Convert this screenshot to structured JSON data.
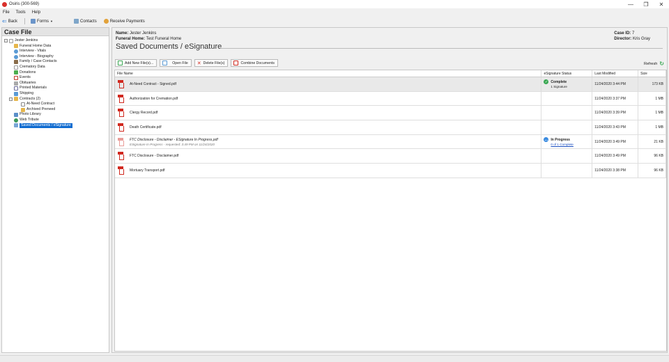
{
  "window": {
    "title": "Osiris (300-569)",
    "minimize": "—",
    "maximize": "❐",
    "close": "✕"
  },
  "menu": {
    "items": [
      "File",
      "Tools",
      "Help"
    ]
  },
  "toolbar": {
    "back": "Back",
    "forms": "Forms",
    "contacts": "Contacts",
    "receive_payments": "Receive Payments"
  },
  "case_file": {
    "title": "Case File",
    "tree": [
      {
        "label": "Jester Jenkins"
      },
      {
        "label": "Funeral Home Data"
      },
      {
        "label": "Interview - Vitals"
      },
      {
        "label": "Interview - Biography"
      },
      {
        "label": "Family / Case Contacts"
      },
      {
        "label": "Crematory Data"
      },
      {
        "label": "Donations"
      },
      {
        "label": "Events"
      },
      {
        "label": "Obituaries"
      },
      {
        "label": "Printed Materials"
      },
      {
        "label": "Shipping"
      },
      {
        "label": "Contracts (2)"
      },
      {
        "label": "At-Need Contract"
      },
      {
        "label": "Archived Preneed"
      },
      {
        "label": "Photo Library"
      },
      {
        "label": "Web Tribute"
      },
      {
        "label": "Saved Documents / eSignature"
      }
    ]
  },
  "header": {
    "name_label": "Name:",
    "name": "Jester Jenkins",
    "funeral_home_label": "Funeral Home:",
    "funeral_home": "Test Funeral Home",
    "case_id_label": "Case ID:",
    "case_id": "7",
    "director_label": "Director:",
    "director": "Kris Gray",
    "page_title": "Saved Documents / eSignature"
  },
  "actions": {
    "add": "Add New File(s)...",
    "open": "Open File",
    "delete": "Delete File(s)",
    "combine": "Combine Documents",
    "refresh": "Refresh"
  },
  "grid": {
    "columns": [
      "File Name",
      "eSignature Status",
      "Last Modified",
      "Size"
    ],
    "rows": [
      {
        "name": "At-Need Contract - Signed.pdf",
        "sub": "",
        "status": "Complete",
        "status_sub": "1 Signature",
        "modified": "11/24/2020 3:44 PM",
        "size": "173 KB"
      },
      {
        "name": "Authorization for Cremation.pdf",
        "sub": "",
        "status": "",
        "status_sub": "",
        "modified": "11/24/2020 3:37 PM",
        "size": "1 MB"
      },
      {
        "name": "Clergy Record.pdf",
        "sub": "",
        "status": "",
        "status_sub": "",
        "modified": "11/24/2020 3:39 PM",
        "size": "1 MB"
      },
      {
        "name": "Death Certificate.pdf",
        "sub": "",
        "status": "",
        "status_sub": "",
        "modified": "11/24/2020 3:43 PM",
        "size": "1 MB"
      },
      {
        "name": "FTC Disclosure - Disclaimer - ESignature In Progress.pdf",
        "sub": "ESignature In Progress - requested: 3:49 PM on 11/24/2020",
        "status": "In Progress",
        "status_sub": "0 of 1 Complete",
        "modified": "11/24/2020 3:49 PM",
        "size": "21 KB"
      },
      {
        "name": "FTC Disclosure - Disclaimer.pdf",
        "sub": "",
        "status": "",
        "status_sub": "",
        "modified": "11/24/2020 3:49 PM",
        "size": "96 KB"
      },
      {
        "name": "Mortuary Transport.pdf",
        "sub": "",
        "status": "",
        "status_sub": "",
        "modified": "11/24/2020 3:38 PM",
        "size": "96 KB"
      }
    ]
  },
  "colors": {
    "accent": "#0f6bd0",
    "complete": "#3aa853",
    "progress": "#3a8be0",
    "pdf": "#d0281e"
  }
}
